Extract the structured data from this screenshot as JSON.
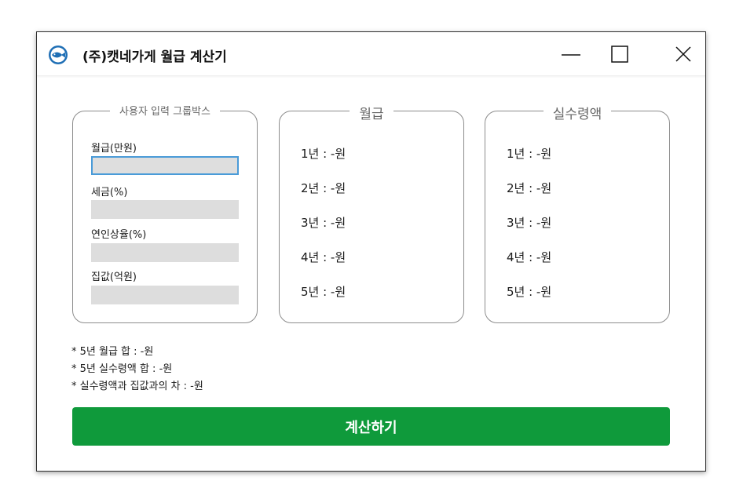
{
  "window": {
    "title": "(주)캣네가게 월급 계산기",
    "icon": "fish-icon",
    "accent_color": "#0f9a3b"
  },
  "input_group": {
    "legend": "사용자 입력 그룹박스",
    "fields": [
      {
        "label": "월급(만원)",
        "value": ""
      },
      {
        "label": "세금(%)",
        "value": ""
      },
      {
        "label": "연인상율(%)",
        "value": ""
      },
      {
        "label": "집값(억원)",
        "value": ""
      }
    ]
  },
  "salary_group": {
    "legend": "월급",
    "rows": [
      "1년 : -원",
      "2년 : -원",
      "3년 : -원",
      "4년 : -원",
      "5년 : -원"
    ]
  },
  "net_group": {
    "legend": "실수령액",
    "rows": [
      "1년 : -원",
      "2년 : -원",
      "3년 : -원",
      "4년 : -원",
      "5년 : -원"
    ]
  },
  "summary": [
    "* 5년 월급 합 : -원",
    "* 5년 실수령액 합 : -원",
    "* 실수령액과 집값과의 차 : -원"
  ],
  "calculate_button": "계산하기"
}
